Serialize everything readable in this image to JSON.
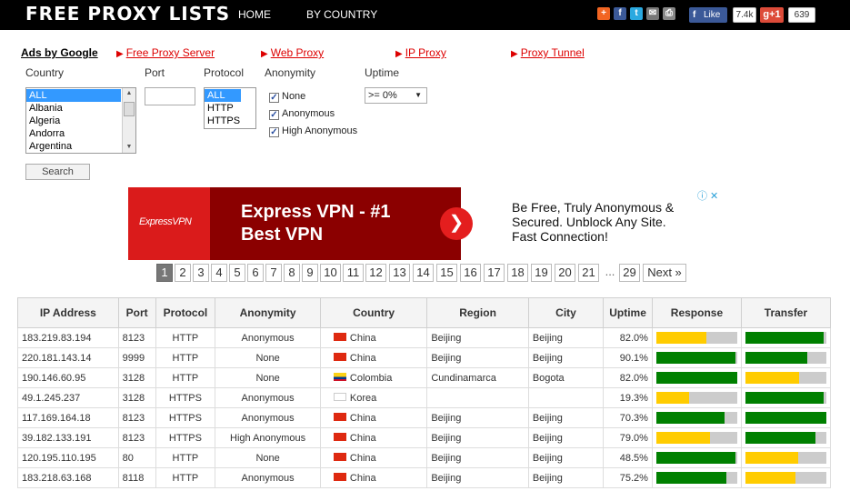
{
  "header": {
    "logo": "FREE PROXY LISTS",
    "nav": [
      {
        "label": "HOME"
      },
      {
        "label": "BY COUNTRY"
      }
    ],
    "fb_like_label": "Like",
    "fb_count": "7.4k",
    "gplus_label": "g+1",
    "gplus_count": "639"
  },
  "ads_row": {
    "ads_by_google": "Ads by Google",
    "links": [
      "Free Proxy Server",
      "Web Proxy",
      "IP Proxy",
      "Proxy Tunnel"
    ]
  },
  "filters": {
    "country_label": "Country",
    "port_label": "Port",
    "protocol_label": "Protocol",
    "anonymity_label": "Anonymity",
    "uptime_label": "Uptime",
    "country_options": [
      "ALL",
      "Albania",
      "Algeria",
      "Andorra",
      "Argentina"
    ],
    "protocol_options": [
      "ALL",
      "HTTP",
      "HTTPS"
    ],
    "anonymity_options": [
      "None",
      "Anonymous",
      "High Anonymous"
    ],
    "uptime_value": ">= 0%",
    "search_label": "Search"
  },
  "ad_banner": {
    "logo": "ExpressVPN",
    "headline": "Express VPN - #1 Best VPN",
    "body": "Be Free, Truly Anonymous & Secured. Unblock Any Site. Fast Connection!"
  },
  "pagination": {
    "pages": [
      "1",
      "2",
      "3",
      "4",
      "5",
      "6",
      "7",
      "8",
      "9",
      "10",
      "11",
      "12",
      "13",
      "14",
      "15",
      "16",
      "17",
      "18",
      "19",
      "20",
      "21"
    ],
    "ellipsis": "...",
    "last": "29",
    "next": "Next »",
    "active": "1"
  },
  "table": {
    "headers": [
      "IP Address",
      "Port",
      "Protocol",
      "Anonymity",
      "Country",
      "Region",
      "City",
      "Uptime",
      "Response",
      "Transfer"
    ],
    "rows": [
      {
        "ip": "183.219.83.194",
        "port": "8123",
        "protocol": "HTTP",
        "anonymity": "Anonymous",
        "country": "China",
        "flag": "cn",
        "region": "Beijing",
        "city": "Beijing",
        "uptime": "82.0%",
        "response": {
          "level": 0.62,
          "color": "#ffcc00"
        },
        "transfer": {
          "level": 0.97,
          "color": "#008000"
        }
      },
      {
        "ip": "220.181.143.14",
        "port": "9999",
        "protocol": "HTTP",
        "anonymity": "None",
        "country": "China",
        "flag": "cn",
        "region": "Beijing",
        "city": "Beijing",
        "uptime": "90.1%",
        "response": {
          "level": 0.98,
          "color": "#008000"
        },
        "transfer": {
          "level": 0.76,
          "color": "#008000"
        }
      },
      {
        "ip": "190.146.60.95",
        "port": "3128",
        "protocol": "HTTP",
        "anonymity": "None",
        "country": "Colombia",
        "flag": "co",
        "region": "Cundinamarca",
        "city": "Bogota",
        "uptime": "82.0%",
        "response": {
          "level": 1.0,
          "color": "#008000"
        },
        "transfer": {
          "level": 0.66,
          "color": "#ffcc00"
        }
      },
      {
        "ip": "49.1.245.237",
        "port": "3128",
        "protocol": "HTTPS",
        "anonymity": "Anonymous",
        "country": "Korea",
        "flag": "kr",
        "region": "",
        "city": "",
        "uptime": "19.3%",
        "response": {
          "level": 0.4,
          "color": "#ffcc00"
        },
        "transfer": {
          "level": 0.97,
          "color": "#008000"
        }
      },
      {
        "ip": "117.169.164.18",
        "port": "8123",
        "protocol": "HTTPS",
        "anonymity": "Anonymous",
        "country": "China",
        "flag": "cn",
        "region": "Beijing",
        "city": "Beijing",
        "uptime": "70.3%",
        "response": {
          "level": 0.84,
          "color": "#008000"
        },
        "transfer": {
          "level": 1.0,
          "color": "#008000"
        }
      },
      {
        "ip": "39.182.133.191",
        "port": "8123",
        "protocol": "HTTPS",
        "anonymity": "High Anonymous",
        "country": "China",
        "flag": "cn",
        "region": "Beijing",
        "city": "Beijing",
        "uptime": "79.0%",
        "response": {
          "level": 0.66,
          "color": "#ffcc00"
        },
        "transfer": {
          "level": 0.86,
          "color": "#008000"
        }
      },
      {
        "ip": "120.195.110.195",
        "port": "80",
        "protocol": "HTTP",
        "anonymity": "None",
        "country": "China",
        "flag": "cn",
        "region": "Beijing",
        "city": "Beijing",
        "uptime": "48.5%",
        "response": {
          "level": 0.98,
          "color": "#008000"
        },
        "transfer": {
          "level": 0.65,
          "color": "#ffcc00"
        }
      },
      {
        "ip": "183.218.63.168",
        "port": "8118",
        "protocol": "HTTP",
        "anonymity": "Anonymous",
        "country": "China",
        "flag": "cn",
        "region": "Beijing",
        "city": "Beijing",
        "uptime": "75.2%",
        "response": {
          "level": 0.86,
          "color": "#008000"
        },
        "transfer": {
          "level": 0.62,
          "color": "#ffcc00"
        }
      }
    ]
  }
}
